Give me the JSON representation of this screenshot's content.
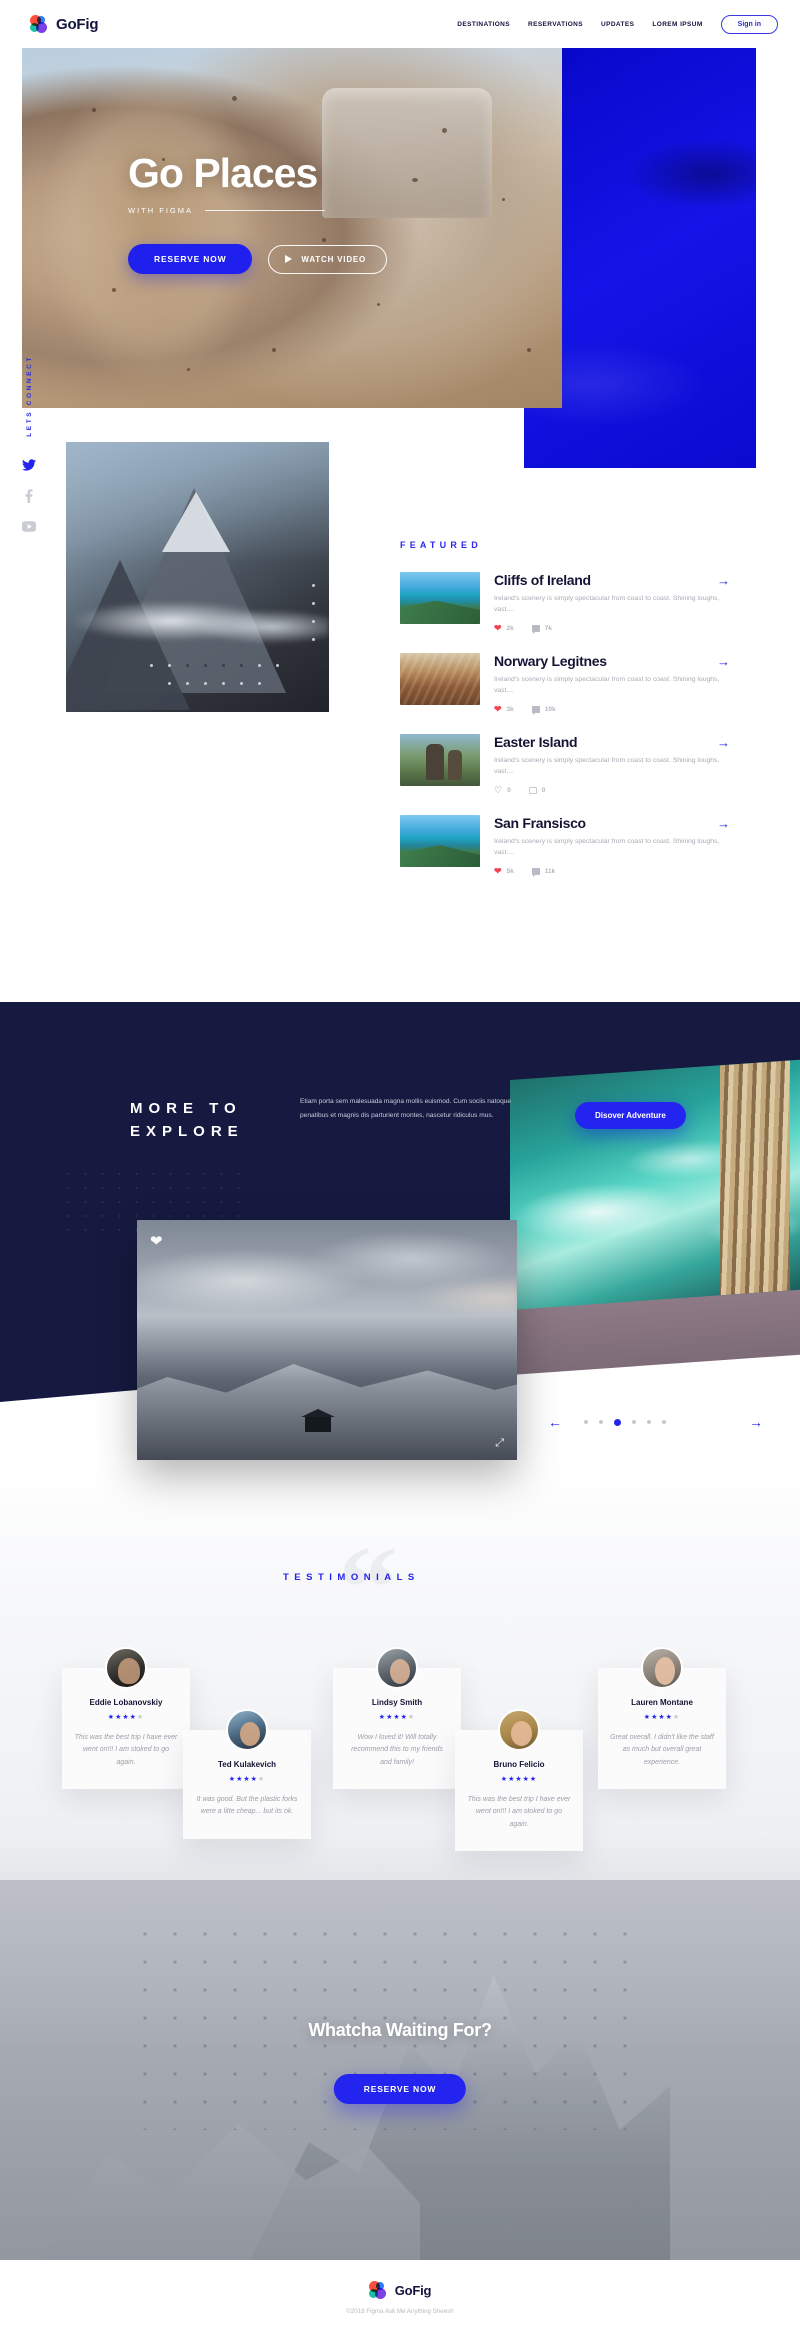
{
  "brand": {
    "name": "GoFig"
  },
  "header": {
    "nav": [
      {
        "label": "DESTINATIONS"
      },
      {
        "label": "RESERVATIONS"
      },
      {
        "label": "UPDATES"
      },
      {
        "label": "LOREM IPSUM"
      }
    ],
    "signin_label": "Sign in"
  },
  "hero": {
    "title": "Go Places",
    "subtitle": "WITH FIGMA",
    "primary_cta": "RESERVE NOW",
    "secondary_cta": "WATCH VIDEO"
  },
  "social_rail": {
    "label": "LETS CONNECT",
    "icons": [
      "twitter-icon",
      "facebook-icon",
      "youtube-icon"
    ]
  },
  "featured": {
    "heading": "FEATURED",
    "items": [
      {
        "title": "Cliffs of Ireland",
        "desc": "Ireland's scenery is simply spectacular from coast to coast. Shining loughs, vast....",
        "likes": "2k",
        "comments": "7k",
        "liked": true
      },
      {
        "title": "Norwary Legitnes",
        "desc": "Ireland's scenery is simply spectacular from coast to coast. Shining loughs, vast....",
        "likes": "3k",
        "comments": "10k",
        "liked": true
      },
      {
        "title": "Easter Island",
        "desc": "Ireland's scenery is simply spectacular from coast to coast. Shining loughs, vast....",
        "likes": "0",
        "comments": "0",
        "liked": false
      },
      {
        "title": "San Fransisco",
        "desc": "Ireland's scenery is simply spectacular from coast to coast. Shining loughs, vast....",
        "likes": "5k",
        "comments": "11k",
        "liked": true
      }
    ]
  },
  "explore": {
    "title_line1": "MORE TO",
    "title_line2": "EXPLORE",
    "copy": "Etiam porta sem malesuada magna mollis euismod. Cum sociis natoque penatibus et magnis dis parturient montes, nascetur ridiculus mus.",
    "cta_label": "Disover Adventure"
  },
  "testimonials": {
    "heading": "TESTIMONIALS",
    "items": [
      {
        "name": "Eddie Lobanovskiy",
        "rating": 4,
        "text": "This was the best trip I have ever went on!!! I am stoked to go again."
      },
      {
        "name": "Ted Kulakevich",
        "rating": 4,
        "text": "It was good. But the plastic forks were a litte cheap... but its ok."
      },
      {
        "name": "Lindsy Smith",
        "rating": 4,
        "text": "Wow I loved it! Will totally recommend this to my friends and family!"
      },
      {
        "name": "Bruno Felicio",
        "rating": 5,
        "text": "This was the best trip I have ever went on!!! I am stoked to go again."
      },
      {
        "name": "Lauren Montane",
        "rating": 4,
        "text": "Great overall. I didn't like the staff as much but overall great experience."
      }
    ]
  },
  "cta": {
    "title": "Whatcha Waiting For?",
    "button": "RESERVE NOW"
  },
  "footer": {
    "brand": "GoFig",
    "copyright": "©2018 Figma Ask Me Anything Sheesh"
  },
  "colors": {
    "accent": "#2424ef",
    "dark": "#161a40",
    "heart": "#f4424f"
  }
}
